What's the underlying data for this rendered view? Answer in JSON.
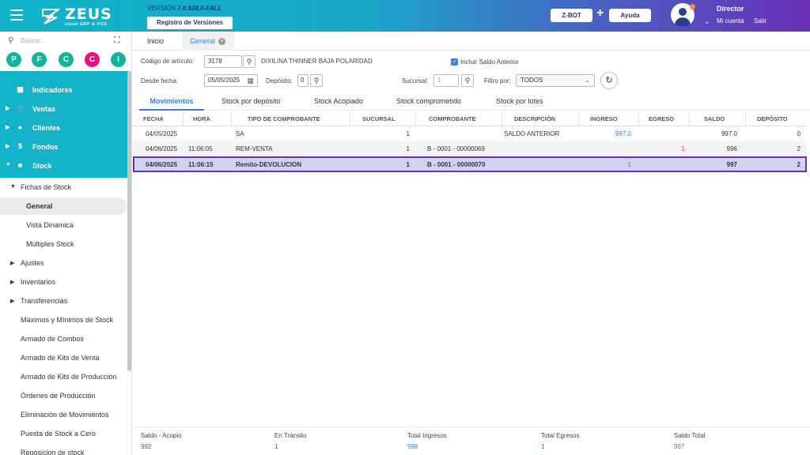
{
  "header": {
    "logo_text": "ZEUS",
    "logo_sub": "cloud ERP & POS",
    "version_label": "VERSIÓN",
    "version_value": "7.6.638.0-FALL",
    "versions_button": "Registro de Versiones",
    "zbot_button": "Z-BOT",
    "plus": "+",
    "help_button": "Ayuda",
    "user_name": "Director",
    "my_account": "Mi cuenta",
    "logout": "Salir"
  },
  "sidebar": {
    "search_placeholder": "Buscar...",
    "favorites": [
      {
        "letter": "P",
        "color": "#14b39a"
      },
      {
        "letter": "F",
        "color": "#14b39a"
      },
      {
        "letter": "C",
        "color": "#14b39a"
      },
      {
        "letter": "C",
        "color": "#e6117f"
      },
      {
        "letter": "I",
        "color": "#14b39a"
      }
    ],
    "modules": [
      {
        "label": "Indicadores",
        "icon": "dashboard-icon"
      },
      {
        "label": "Ventas",
        "icon": "cart-icon"
      },
      {
        "label": "Clientes",
        "icon": "people-icon"
      },
      {
        "label": "Fondos",
        "icon": "dollar-icon"
      },
      {
        "label": "Stock",
        "icon": "box-icon"
      }
    ],
    "stock_items": [
      {
        "label": "Fichas de Stock",
        "caret": "down"
      },
      {
        "label": "General",
        "level": 2
      },
      {
        "label": "Vista Dinamica",
        "level": 2
      },
      {
        "label": "Múltiples Stock",
        "level": 2
      },
      {
        "label": "Ajustes",
        "caret": "right"
      },
      {
        "label": "Inventarios",
        "caret": "right"
      },
      {
        "label": "Transferencias",
        "caret": "right"
      },
      {
        "label": "Máximos y Mínimos de Stock"
      },
      {
        "label": "Armado de Combos"
      },
      {
        "label": "Armado de Kits de Venta"
      },
      {
        "label": "Armado de Kits de Producción"
      },
      {
        "label": "Órdenes de Producción"
      },
      {
        "label": "Eliminación de Movimientos"
      },
      {
        "label": "Puesta de Stock a Cero"
      },
      {
        "label": "Reposicion de stock"
      }
    ]
  },
  "tabs": {
    "inicio": "Inicio",
    "general": "General"
  },
  "form": {
    "article_code_label": "Código de artículo:",
    "article_code_value": "3178",
    "article_description": "DIXILINA THINNER BAJA POLARIDAD",
    "include_balance_label": "Incluir Saldo Anterior",
    "from_date_label": "Desde fecha:",
    "from_date_value": "05/05/2025",
    "deposit_label": "Depósito:",
    "deposit_value": "0",
    "branch_label": "Sucursal:",
    "branch_value": "1",
    "filter_label": "Filtro por:",
    "filter_value": "TODOS"
  },
  "sub_tabs": [
    "Movimientos",
    "Stock por depósito",
    "Stock Acopiado",
    "Stock comprometido",
    "Stock por lotes"
  ],
  "table": {
    "columns": [
      "FECHA",
      "HORA",
      "TIPO DE COMPROBANTE",
      "SUCURSAL",
      "COMPROBANTE",
      "DESCRIPCIÓN",
      "INGRESO",
      "EGRESO",
      "SALDO",
      "DEPÓSITO"
    ],
    "rows": [
      {
        "fecha": "04/05/2025",
        "hora": "",
        "tipo": "SA",
        "sucursal": "1",
        "comprobante": "",
        "descripcion": "SALDO ANTERIOR",
        "ingreso": "997.0",
        "egreso": "",
        "saldo": "997.0",
        "deposito": "0"
      },
      {
        "fecha": "04/06/2025",
        "hora": "11:06:05",
        "tipo": "REM-VENTA",
        "sucursal": "1",
        "comprobante": "B - 0001 - 00000069",
        "descripcion": "",
        "ingreso": "",
        "egreso": "1",
        "saldo": "996",
        "deposito": "2"
      },
      {
        "fecha": "04/06/2025",
        "hora": "11:06:15",
        "tipo": "Remito-DEVOLUCION",
        "sucursal": "1",
        "comprobante": "B - 0001 - 00000070",
        "descripcion": "",
        "ingreso": "1",
        "egreso": "",
        "saldo": "997",
        "deposito": "2"
      }
    ]
  },
  "footer": {
    "acopio_label": "Saldo - Acopio",
    "acopio_value": "992",
    "transit_label": "En Tránsito",
    "transit_value": "1",
    "total_in_label": "Total Ingresos",
    "total_in_value": "998",
    "total_out_label": "Total Egresos",
    "total_out_value": "1",
    "total_balance_label": "Saldo Total",
    "total_balance_value": "997"
  },
  "colors": {
    "accent": "#3a7fd5",
    "teal": "#13b3c8",
    "purple": "#6b2fb6",
    "red": "#e33"
  }
}
